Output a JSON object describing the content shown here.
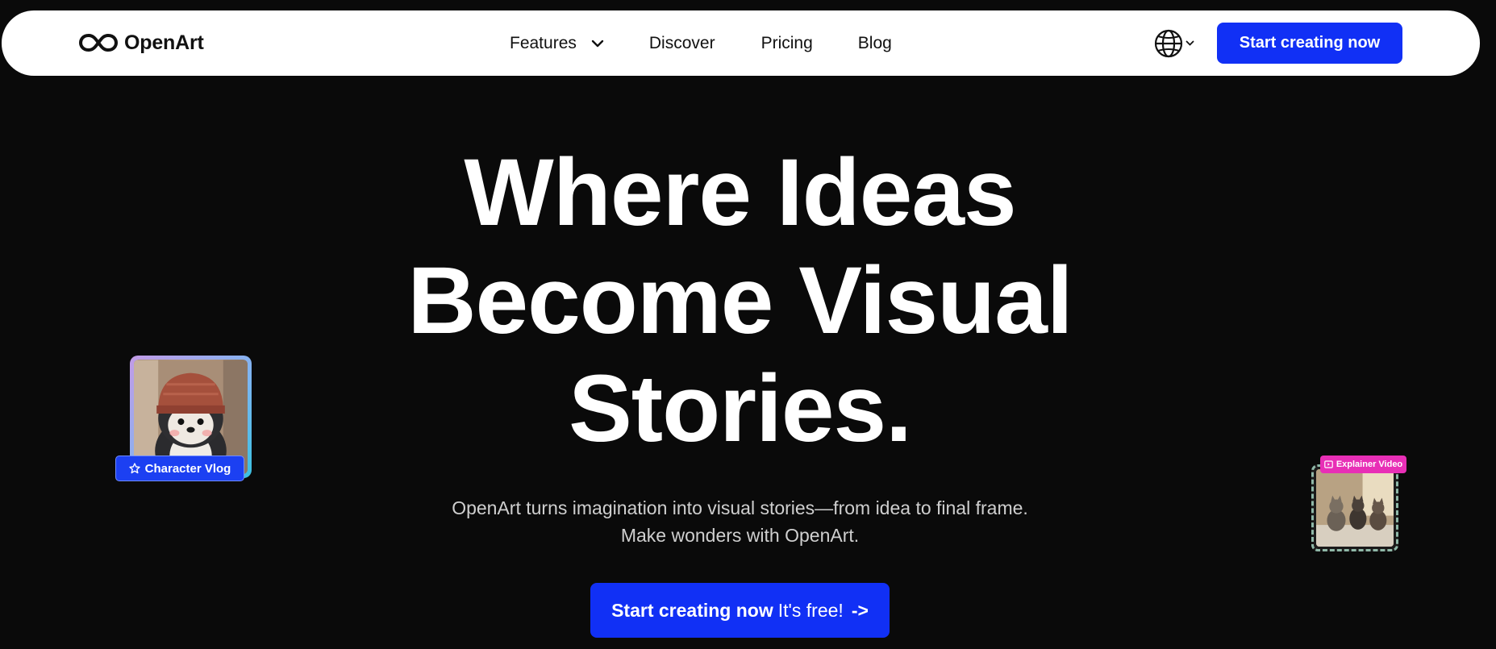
{
  "brand": {
    "name": "OpenArt"
  },
  "nav": {
    "links": [
      {
        "label": "Features",
        "has_dropdown": true
      },
      {
        "label": "Discover"
      },
      {
        "label": "Pricing"
      },
      {
        "label": "Blog"
      }
    ],
    "language_icon": "globe-icon",
    "cta_label": "Start creating now"
  },
  "hero": {
    "headline_lines": [
      "Where Ideas",
      "Become Visual",
      "Stories."
    ],
    "subtitle_lines": [
      "OpenArt turns imagination into visual stories—from idea to final frame.",
      "Make wonders with OpenArt."
    ],
    "cta": {
      "strong": "Start creating now",
      "normal": "It's free!",
      "arrow": "->"
    }
  },
  "cards": {
    "left_tag": "Character Vlog",
    "right_tag": "Explainer Video"
  },
  "colors": {
    "background": "#0a0a0a",
    "accent": "#1130f5",
    "tag_pink": "#e82fb6",
    "nav_bg": "#ffffff"
  }
}
